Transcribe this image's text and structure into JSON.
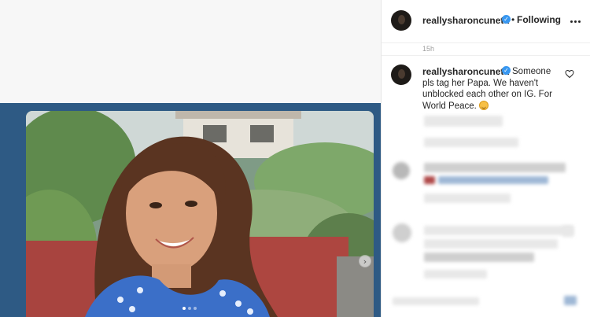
{
  "post": {
    "header": {
      "username": "reallysharoncuneta",
      "bullet": "•",
      "follow_status": "Following"
    },
    "timestamp": "15h",
    "caption": {
      "username": "reallysharoncuneta",
      "text": "Someone pls tag her Papa. We haven't unblocked each other on IG. For World Peace."
    },
    "media": {
      "carousel_count": 3,
      "active_index": 1,
      "next_arrow": "›"
    }
  },
  "colors": {
    "verified": "#3897f0",
    "media_background": "#2e5a84",
    "text": "#262626"
  },
  "icons": [
    "verified-badge-icon",
    "more-options-icon",
    "heart-icon",
    "smiling-face-emoji-icon",
    "chevron-right-icon"
  ]
}
